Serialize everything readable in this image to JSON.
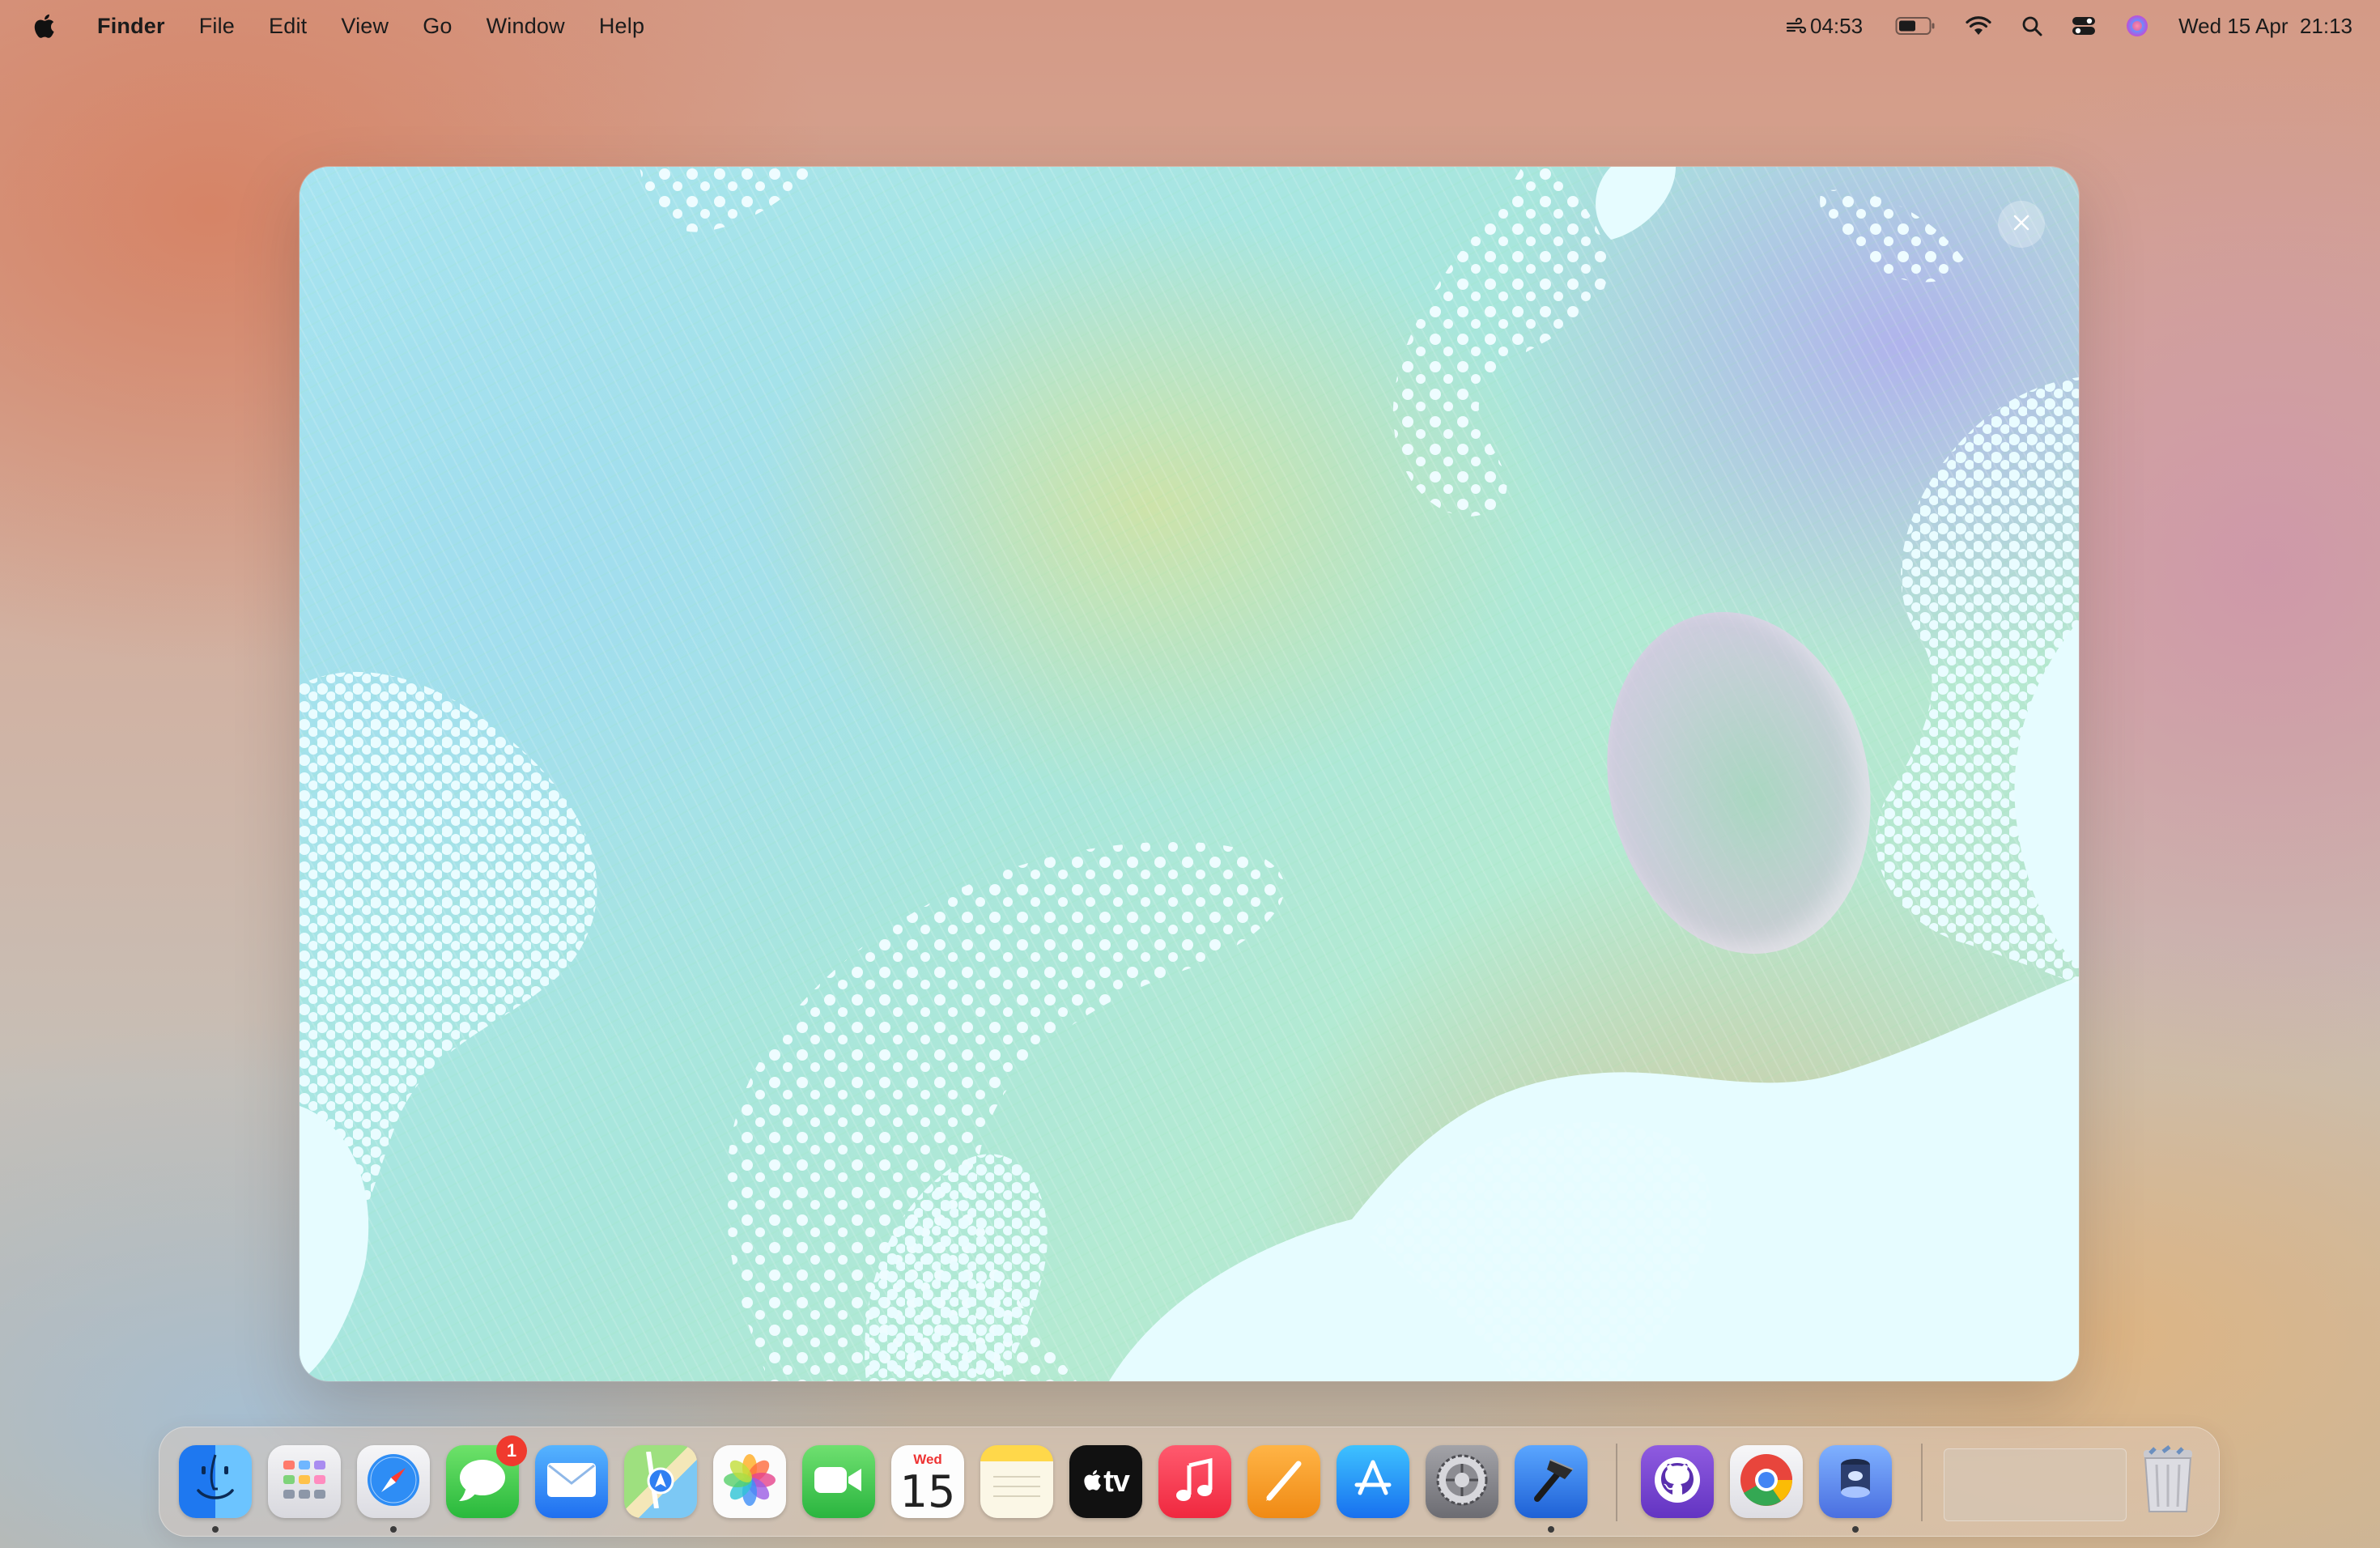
{
  "menubar": {
    "apple_icon": "apple-logo-icon",
    "app_name": "Finder",
    "menus": [
      "File",
      "Edit",
      "View",
      "Go",
      "Window",
      "Help"
    ],
    "status": {
      "weather_icon": "wind-icon",
      "time_left": "04:53",
      "battery_icon": "battery-icon",
      "wifi_icon": "wifi-icon",
      "search_icon": "spotlight-search-icon",
      "control_center_icon": "control-center-icon",
      "siri_icon": "siri-icon",
      "datetime": "Wed 15 Apr  21:13"
    }
  },
  "panel": {
    "close_icon": "close-icon"
  },
  "dock": {
    "apps": [
      {
        "name": "Finder",
        "icon": "finder-icon",
        "running": true
      },
      {
        "name": "Launchpad",
        "icon": "launchpad-icon",
        "running": false
      },
      {
        "name": "Safari",
        "icon": "safari-icon",
        "running": true
      },
      {
        "name": "Messages",
        "icon": "messages-icon",
        "running": false,
        "badge": "1"
      },
      {
        "name": "Mail",
        "icon": "mail-icon",
        "running": false
      },
      {
        "name": "Maps",
        "icon": "maps-icon",
        "running": false
      },
      {
        "name": "Photos",
        "icon": "photos-icon",
        "running": false
      },
      {
        "name": "FaceTime",
        "icon": "facetime-icon",
        "running": false
      },
      {
        "name": "Calendar",
        "icon": "calendar-icon",
        "running": false,
        "day": "Wed",
        "date": "15"
      },
      {
        "name": "Notes",
        "icon": "notes-icon",
        "running": false
      },
      {
        "name": "TV",
        "icon": "apple-tv-icon",
        "running": false,
        "label": "tv"
      },
      {
        "name": "Music",
        "icon": "music-icon",
        "running": false
      },
      {
        "name": "Pages",
        "icon": "pages-icon",
        "running": false
      },
      {
        "name": "App Store",
        "icon": "app-store-icon",
        "running": false
      },
      {
        "name": "System Settings",
        "icon": "system-settings-icon",
        "running": false
      },
      {
        "name": "Xcode",
        "icon": "xcode-icon",
        "running": true
      },
      {
        "name": "GitHub Desktop",
        "icon": "github-icon",
        "running": false
      },
      {
        "name": "Google Chrome",
        "icon": "chrome-icon",
        "running": false
      },
      {
        "name": "Screen Saver",
        "icon": "screensaver-app-icon",
        "running": true
      }
    ],
    "trash_icon": "trash-icon"
  }
}
